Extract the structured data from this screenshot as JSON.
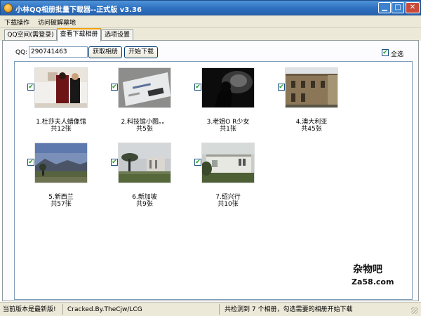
{
  "window": {
    "title": "小林QQ相册批量下载器--正式版 v3.36"
  },
  "menu": {
    "items": [
      "下载操作",
      "访问破解墓地"
    ]
  },
  "tabs": [
    "QQ空间(需登录)",
    "查看下载相册",
    "选项设置"
  ],
  "active_tab": "查看下载相册",
  "form": {
    "qq_label": "QQ:",
    "qq_value": "290741463",
    "get_albums_button": "获取相册",
    "start_download_button": "开始下载",
    "select_all_label": "全选",
    "select_all_checked": true
  },
  "albums": [
    {
      "index_name": "1.杜莎夫人蜡像馆",
      "count": "共12张",
      "checked": true
    },
    {
      "index_name": "2.科技馆小图。。",
      "count": "共5张",
      "checked": true
    },
    {
      "index_name": "3.老姐O R少女",
      "count": "共1张",
      "checked": true
    },
    {
      "index_name": "4.澳大利亚",
      "count": "共45张",
      "checked": true
    },
    {
      "index_name": "5.新西兰",
      "count": "共57张",
      "checked": true
    },
    {
      "index_name": "6.新加坡",
      "count": "共9张",
      "checked": true
    },
    {
      "index_name": "7.绍兴行",
      "count": "共10张",
      "checked": true
    }
  ],
  "watermark": {
    "line1": "杂物吧",
    "line2": "Za58.com"
  },
  "status": {
    "version": "当前版本是最新版!",
    "credit": "Cracked.By.TheCjw/LCG",
    "message": "共检测到 7 个相册，勾选需要的相册开始下载"
  },
  "icons": [
    "app-icon",
    "minimize-icon",
    "maximize-icon",
    "close-icon",
    "checkbox-checked-icon",
    "resize-grip-icon"
  ]
}
